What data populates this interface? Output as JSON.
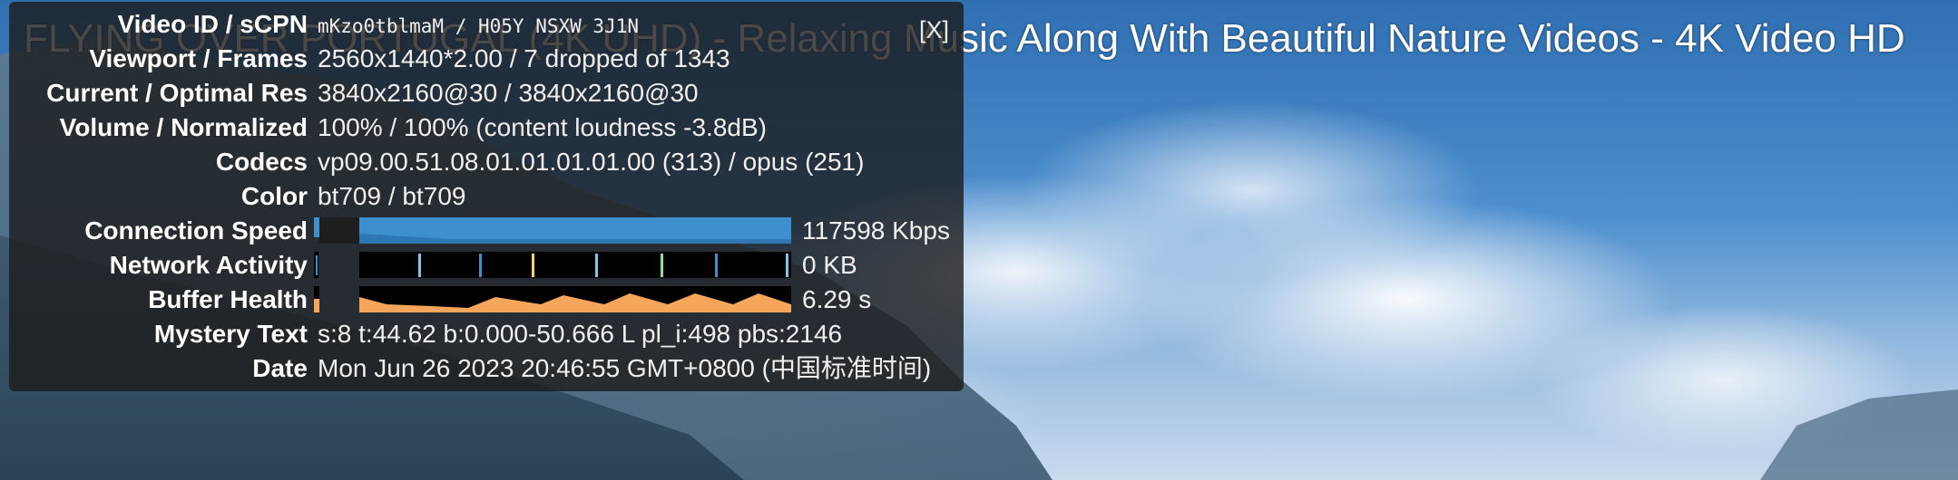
{
  "video": {
    "title": "FLYING OVER PORTUGAL (4K UHD) - Relaxing Music Along With Beautiful Nature Videos - 4K Video HD"
  },
  "stats": {
    "close_label": "[X]",
    "rows": [
      {
        "label": "Video ID / sCPN",
        "value": "mKzo0tblmaM / H05Y NSXW 3J1N"
      },
      {
        "label": "Viewport / Frames",
        "value": "2560x1440*2.00 / 7 dropped of 1343"
      },
      {
        "label": "Current / Optimal Res",
        "value": "3840x2160@30 / 3840x2160@30"
      },
      {
        "label": "Volume / Normalized",
        "value": "100% / 100% (content loudness -3.8dB)"
      },
      {
        "label": "Codecs",
        "value": "vp09.00.51.08.01.01.01.01.00 (313) / opus (251)"
      },
      {
        "label": "Color",
        "value": "bt709 / bt709"
      },
      {
        "label": "Connection Speed",
        "value": "117598 Kbps"
      },
      {
        "label": "Network Activity",
        "value": "0 KB"
      },
      {
        "label": "Buffer Health",
        "value": "6.29 s"
      },
      {
        "label": "Mystery Text",
        "value": "s:8 t:44.62 b:0.000-50.666 L pl_i:498 pbs:2146"
      },
      {
        "label": "Date",
        "value": "Mon Jun 26 2023 20:46:55 GMT+0800 (中国标准时间)"
      }
    ],
    "colors": {
      "connection": "#3d8fce",
      "network_bg": "#000000",
      "network_spike": "#7ec6e8",
      "buffer": "#f5a65b"
    }
  }
}
